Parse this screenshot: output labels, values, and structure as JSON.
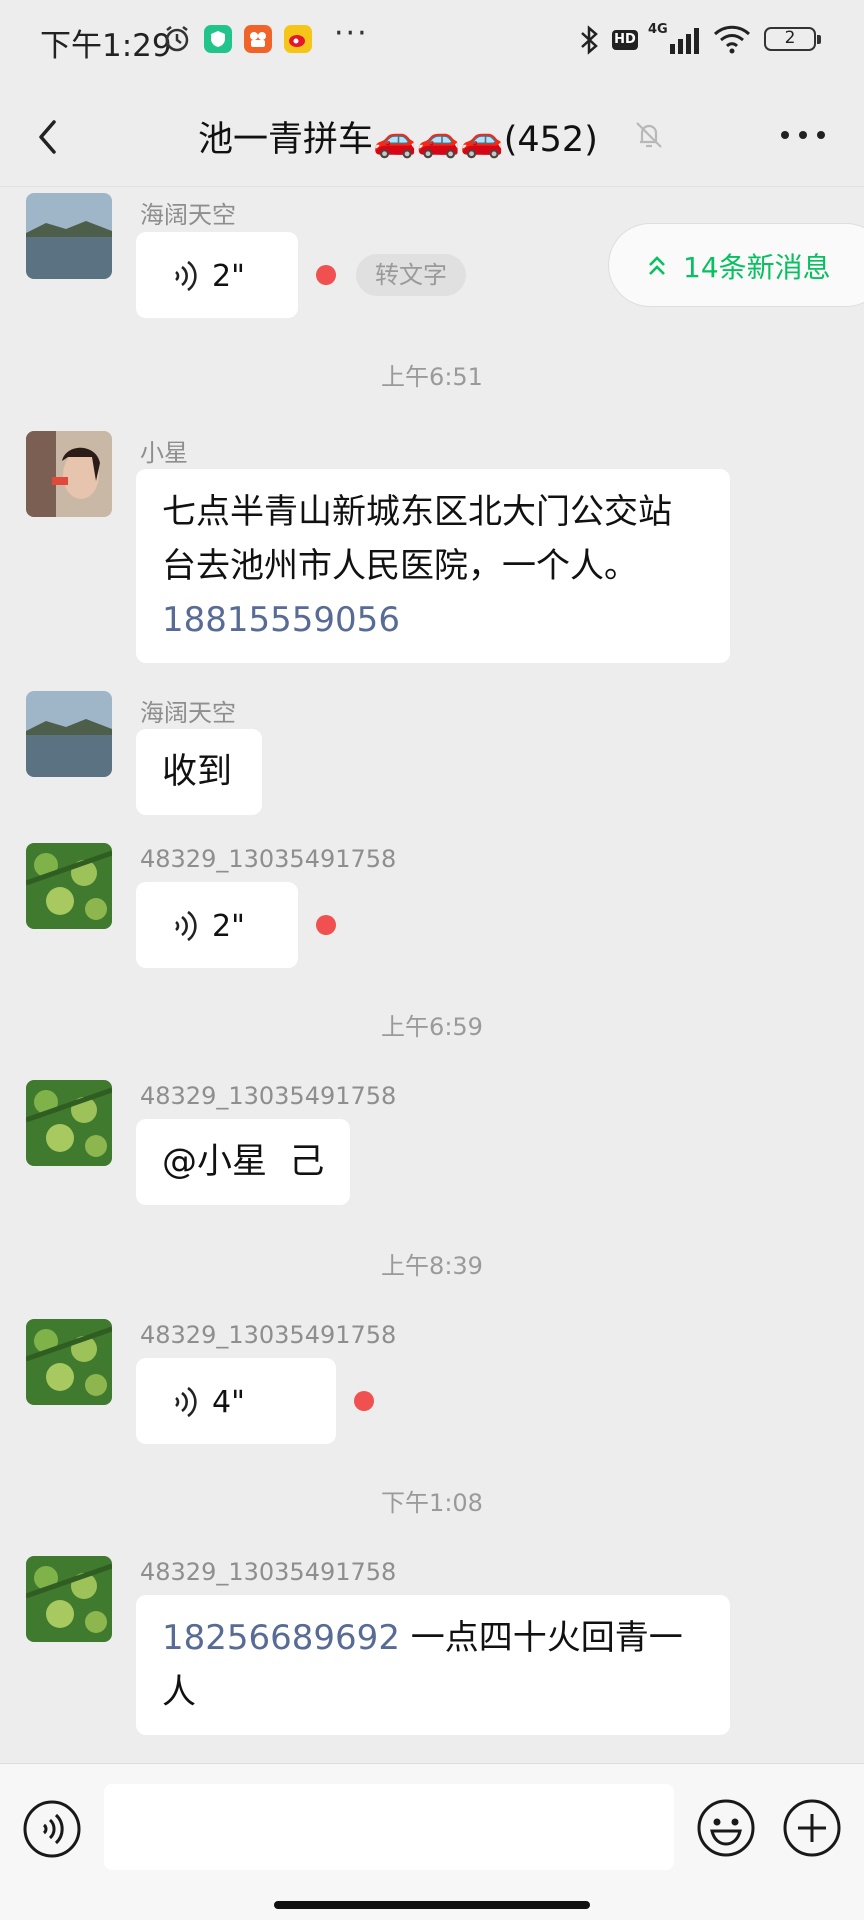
{
  "status_bar": {
    "time": "下午1:29",
    "network": "4G",
    "hd": "HD",
    "battery": "2",
    "more_dots": "···"
  },
  "header": {
    "title": "池一青拼车🚗🚗🚗(452)"
  },
  "new_messages": {
    "label": "14条新消息"
  },
  "messages": [
    {
      "sender": "海阔天空",
      "voice_duration": "2\"",
      "to_text_label": "转文字"
    },
    {
      "timestamp": "上午6:51"
    },
    {
      "sender": "小星",
      "text_line1": "七点半青山新城东区北大门公交站",
      "text_line2": "台去池州市人民医院，一个人。",
      "phone": "18815559056"
    },
    {
      "sender": "海阔天空",
      "text": "收到"
    },
    {
      "sender": "48329_13035491758",
      "voice_duration": "2\""
    },
    {
      "timestamp": "上午6:59"
    },
    {
      "sender": "48329_13035491758",
      "text": "@小星  己"
    },
    {
      "timestamp": "上午8:39"
    },
    {
      "sender": "48329_13035491758",
      "voice_duration": "4\""
    },
    {
      "timestamp": "下午1:08"
    },
    {
      "sender": "48329_13035491758",
      "phone": "18256689692",
      "text_line1_rest": " 一点四十火回青一",
      "text_line2": "人"
    }
  ],
  "input": {
    "placeholder": ""
  },
  "colors": {
    "background": "#ededed",
    "accent_green": "#07c160",
    "link_blue": "#576b95",
    "unread_red": "#f05050"
  },
  "icons": [
    "back-arrow-icon",
    "mute-bell-icon",
    "more-icon",
    "voice-wave-icon",
    "double-chevron-up-icon",
    "voice-input-icon",
    "emoji-icon",
    "plus-icon",
    "bluetooth-icon",
    "wifi-icon",
    "alarm-icon"
  ]
}
